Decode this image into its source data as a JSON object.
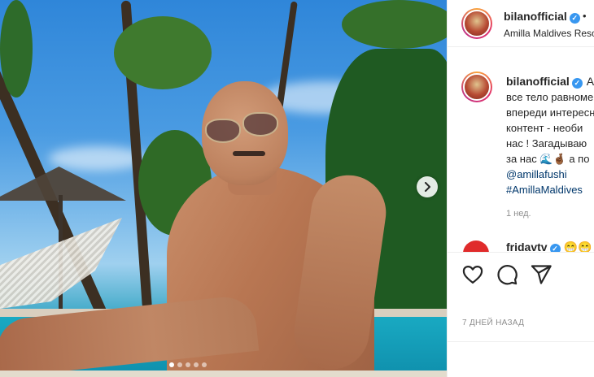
{
  "post": {
    "author": "bilanofficial",
    "location": "Amilla Maldives Resort",
    "header_bullet": "•",
    "verified_mark": "✓"
  },
  "caption": {
    "author": "bilanofficial",
    "lines": [
      "Ai",
      "все тело равномер",
      "впереди интересн",
      "контент - необи",
      "нас ! Загадываю",
      "за нас"
    ],
    "line6_tail": "а по",
    "mention": "@amillafushi",
    "hashtag": "#AmillaMaldives",
    "time": "1 нед."
  },
  "next_comment": {
    "author": "fridavtv",
    "emoji": "😁😁"
  },
  "caption_emoji": "🌊🤞🏾",
  "actions": {
    "like_icon": "heart-icon",
    "comment_icon": "comment-icon",
    "share_icon": "paper-plane-icon"
  },
  "date": "7 ДНЕЙ НАЗАД",
  "carousel": {
    "next_icon": "chevron-right-icon",
    "dots_count": 5,
    "active_index": 0
  },
  "colors": {
    "verified": "#3897f0",
    "link": "#00376b",
    "muted": "#8e8e8e"
  }
}
